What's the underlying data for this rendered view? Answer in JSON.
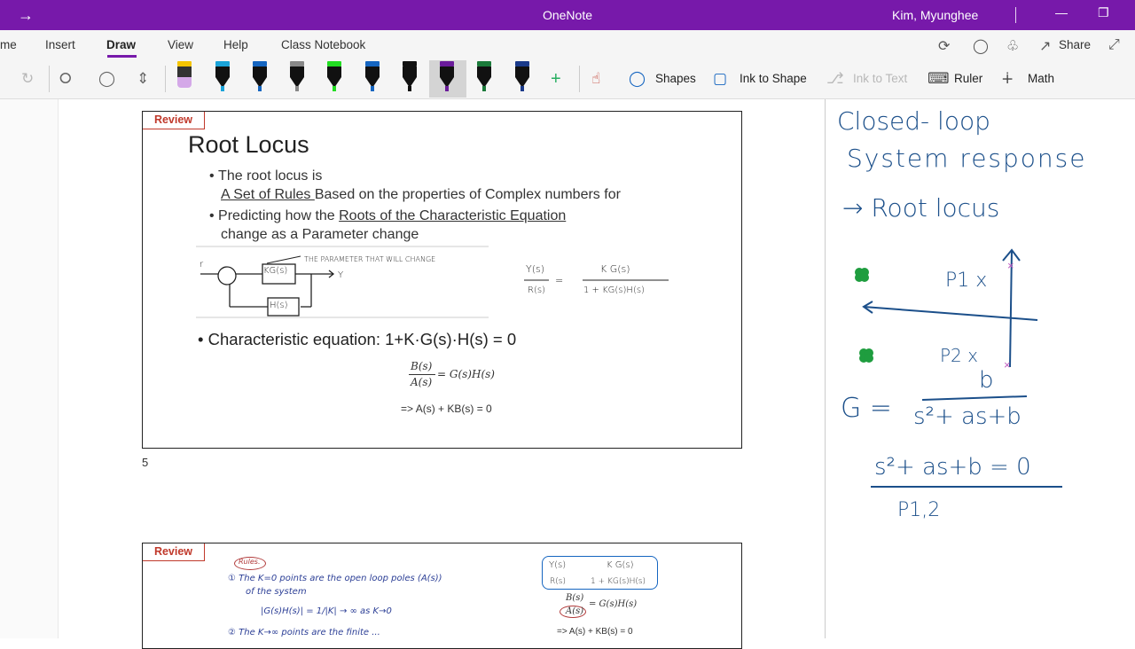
{
  "titlebar": {
    "app_title": "OneNote",
    "user_name": "Kim, Myunghee"
  },
  "tabs": [
    {
      "label": "me"
    },
    {
      "label": "Insert"
    },
    {
      "label": "Draw"
    },
    {
      "label": "View"
    },
    {
      "label": "Help"
    },
    {
      "label": "Class Notebook"
    }
  ],
  "ribbon_right": {
    "share_label": "Share"
  },
  "toolbar": {
    "shapes_label": "Shapes",
    "ink_to_shape_label": "Ink to Shape",
    "ink_to_text_label": "Ink to Text",
    "ruler_label": "Ruler",
    "math_label": "Math",
    "pens": [
      {
        "name": "highlighter-pen",
        "color": "#d4a8e8",
        "band": "#f5c400"
      },
      {
        "name": "pen-blue-1",
        "color": "#1aa3d9"
      },
      {
        "name": "pen-blue-2",
        "color": "#1565c0"
      },
      {
        "name": "pen-gray",
        "color": "#888888"
      },
      {
        "name": "pen-green-bright",
        "color": "#22dd22"
      },
      {
        "name": "pen-blue-3",
        "color": "#1565c0"
      },
      {
        "name": "pen-black",
        "color": "#111111"
      },
      {
        "name": "pen-purple",
        "color": "#6a1b9a"
      },
      {
        "name": "pen-green",
        "color": "#1b7a3a"
      },
      {
        "name": "pen-navy",
        "color": "#1a3a8a"
      }
    ]
  },
  "slide1": {
    "tag": "Review",
    "title": "Root Locus",
    "bullet1_line1": "The root locus is",
    "bullet1_line2_underlined": "A Set of Rules ",
    "bullet1_line2_rest": "Based on the properties of Complex numbers for",
    "bullet2_prefix": "Predicting how the ",
    "bullet2_underlined": "Roots of the Characteristic Equation",
    "bullet2_line2": "change as a Parameter change",
    "diagram_note": "THE PARAMETER THAT WILL CHANGE",
    "block_kg": "KG(s)",
    "block_h": "H(s)",
    "signal_r": "r",
    "signal_y": "Y",
    "tf_numerator_left": "Y(s)",
    "tf_denominator_left": "R(s)",
    "tf_numerator_right": "K G(s)",
    "tf_denominator_right": "1 + KG(s)H(s)",
    "char_eq": "Characteristic equation: 1+K·G(s)·H(s) = 0",
    "frac_num": "B(s)",
    "frac_den": "A(s)",
    "frac_rhs": "= G(s)H(s)",
    "arrow_eq": "=> A(s) + KB(s) = 0"
  },
  "page_number": "5",
  "slide2": {
    "tag": "Review",
    "rules_label": "Rules.",
    "rule1_line1": "① The K=0 points are the open loop poles (A(s))",
    "rule1_line2": "of the system",
    "rule1_line3": "|G(s)H(s)| = 1/|K| → ∞   as  K→0",
    "rule2_line1": "② The K→∞ points are the finite ...",
    "tf_num_left": "Y(s)",
    "tf_den_left": "R(s)",
    "tf_num_right": "K G(s)",
    "tf_den_right": "1 + KG(s)H(s)",
    "frac_num": "B(s)",
    "frac_den": "A(s)",
    "frac_rhs": "= G(s)H(s)",
    "arrow_eq": "=> A(s) + KB(s) = 0"
  },
  "handwritten_notes": {
    "line1": "Closed- loop",
    "line2": "System  response",
    "line3": "→ Root locus",
    "pole1": "P1 x",
    "pole2": "P2 x",
    "g_eq_lhs": "G =",
    "g_num": "b",
    "g_den": "s²+ as+b",
    "char_eq": "s²+ as+b = 0",
    "poles_label": "P1,2"
  },
  "colors": {
    "accent": "#7719aa",
    "review_red": "#c0392b",
    "ink_blue": "#1b4f8a",
    "pole_green": "#1f9d3f"
  }
}
